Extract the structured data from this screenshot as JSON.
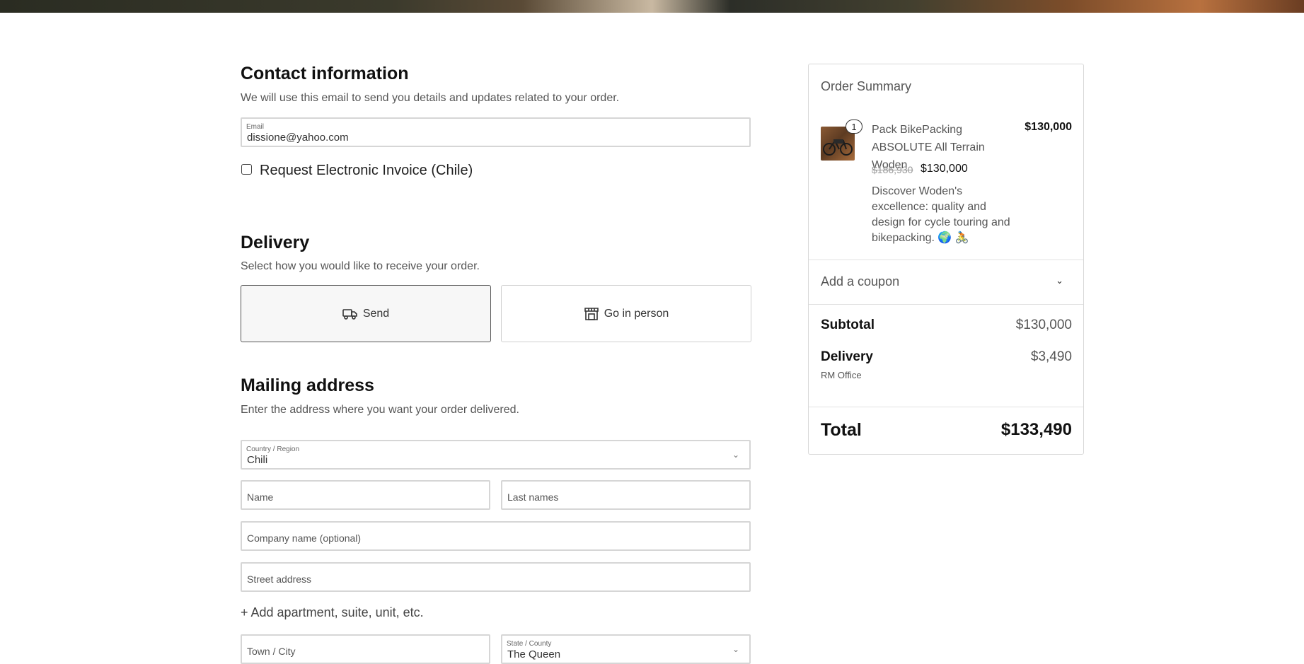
{
  "contact": {
    "title": "Contact information",
    "subtitle": "We will use this email to send you details and updates related to your order.",
    "email_label": "Email",
    "email_value": "dissione@yahoo.com",
    "invoice_label": "Request Electronic Invoice (Chile)"
  },
  "delivery": {
    "title": "Delivery",
    "subtitle": "Select how you would like to receive your order.",
    "options": [
      {
        "label": "Send",
        "icon": "truck-icon",
        "selected": true
      },
      {
        "label": "Go in person",
        "icon": "store-icon",
        "selected": false
      }
    ]
  },
  "mailing": {
    "title": "Mailing address",
    "subtitle": "Enter the address where you want your order delivered.",
    "country_label": "Country / Region",
    "country_value": "Chili",
    "name_placeholder": "Name",
    "lastname_placeholder": "Last names",
    "company_placeholder": "Company name (optional)",
    "street_placeholder": "Street address",
    "add_apartment": "+ Add apartment, suite, unit, etc.",
    "city_placeholder": "Town / City",
    "state_label": "State / County",
    "state_value": "The Queen"
  },
  "summary": {
    "title": "Order Summary",
    "product": {
      "quantity": "1",
      "name": "Pack BikePacking ABSOLUTE All Terrain Woden",
      "price": "$130,000",
      "original_price": "$186,930",
      "sale_price": "$130,000",
      "description": "Discover Woden's excellence: quality and design for cycle touring and bikepacking. 🌍 🚴"
    },
    "coupon_label": "Add a coupon",
    "subtotal_label": "Subtotal",
    "subtotal_value": "$130,000",
    "delivery_label": "Delivery",
    "delivery_value": "$3,490",
    "delivery_note": "RM Office",
    "total_label": "Total",
    "total_value": "$133,490"
  }
}
